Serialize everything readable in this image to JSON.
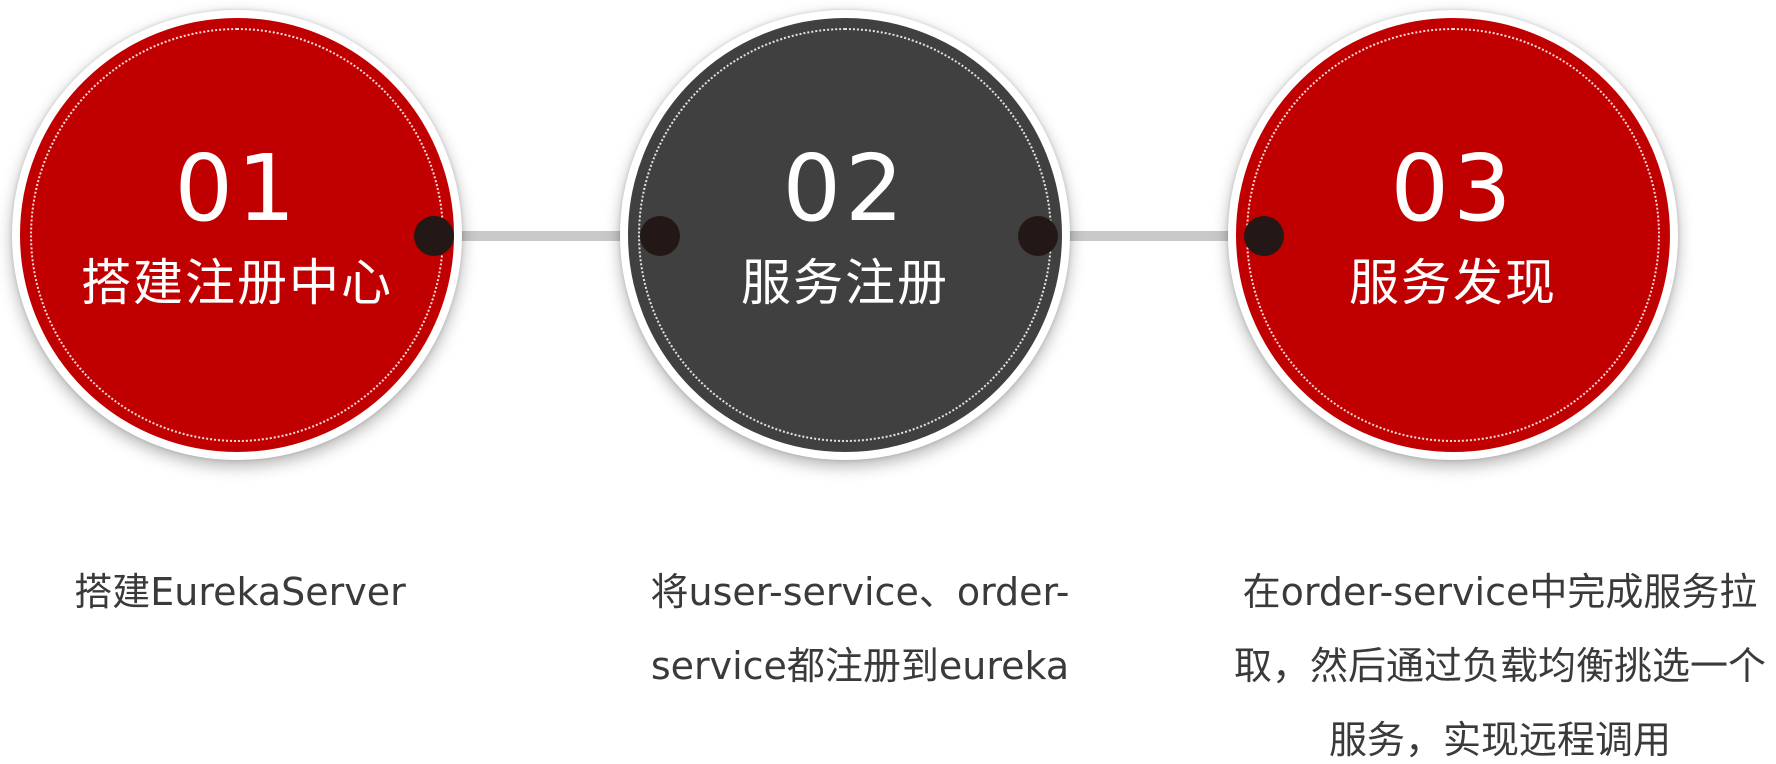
{
  "colors": {
    "red": "#c00000",
    "dark": "#404040",
    "connector": "#c9c9c9",
    "dot": "#231815",
    "text": "#3a3a3a"
  },
  "steps": [
    {
      "number": "01",
      "title": "搭建注册中心",
      "desc": "搭建EurekaServer"
    },
    {
      "number": "02",
      "title": "服务注册",
      "desc": "将user-service、order-service都注册到eureka"
    },
    {
      "number": "03",
      "title": "服务发现",
      "desc": "在order-service中完成服务拉取，然后通过负载均衡挑选一个服务，实现远程调用"
    }
  ]
}
